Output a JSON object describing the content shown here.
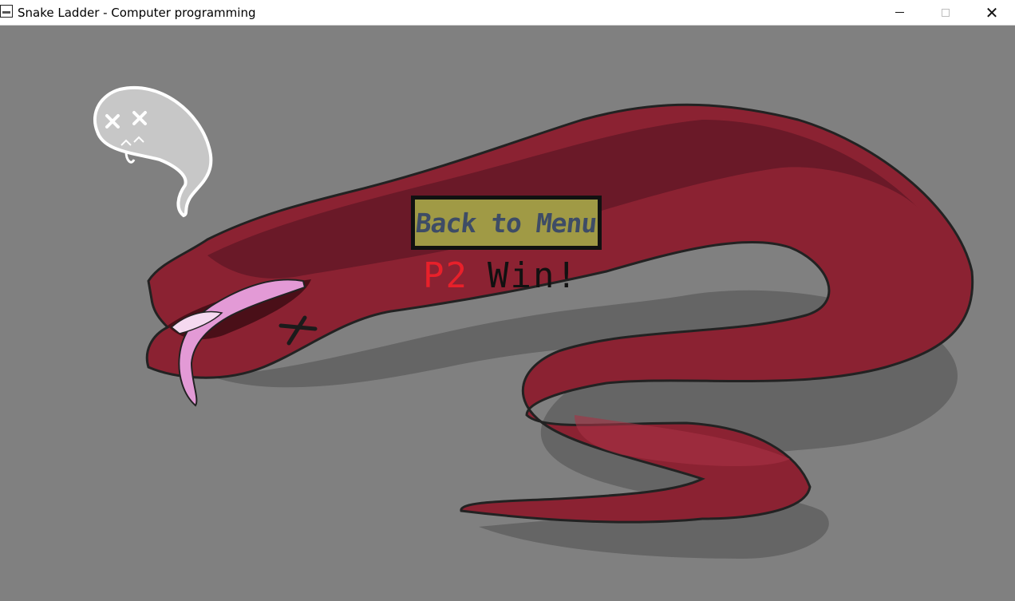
{
  "window": {
    "title": "Snake Ladder - Computer programming",
    "minimize_icon": "minimize-icon",
    "maximize_icon": "maximize-icon",
    "close_icon": "close-icon",
    "close_glyph": "✕"
  },
  "game": {
    "background_color": "#808080",
    "snake_color": "#8b2232",
    "back_button": {
      "label": "Back to Menu",
      "color": "#a09a45",
      "text_color": "#3e4c66"
    },
    "result": {
      "player": "P2",
      "message": "Win!",
      "player_color": "#e8202a",
      "message_color": "#111111"
    }
  }
}
